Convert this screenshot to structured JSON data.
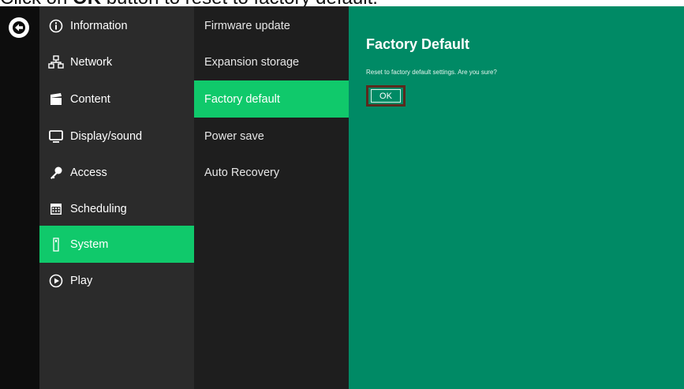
{
  "caption": {
    "prefix": "Click on ",
    "bold": "OK",
    "suffix": " button to reset to factory default."
  },
  "back_button": {
    "icon": "back-arrow-icon"
  },
  "menu": {
    "items": [
      {
        "label": "Information",
        "icon": "info-icon"
      },
      {
        "label": "Network",
        "icon": "network-icon"
      },
      {
        "label": "Content",
        "icon": "clapperboard-icon"
      },
      {
        "label": "Display/sound",
        "icon": "monitor-icon"
      },
      {
        "label": "Access",
        "icon": "key-icon"
      },
      {
        "label": "Scheduling",
        "icon": "calendar-icon"
      },
      {
        "label": "System",
        "icon": "system-icon",
        "active": true
      },
      {
        "label": "Play",
        "icon": "play-icon"
      }
    ]
  },
  "submenu": {
    "items": [
      {
        "label": "Firmware update"
      },
      {
        "label": "Expansion storage"
      },
      {
        "label": "Factory default",
        "active": true
      },
      {
        "label": "Power save"
      },
      {
        "label": "Auto Recovery"
      }
    ]
  },
  "content": {
    "title": "Factory Default",
    "message": "Reset to factory default settings. Are you sure?",
    "ok_label": "OK"
  },
  "colors": {
    "accent": "#10c96b",
    "panel": "#008a65",
    "menu_bg": "#2b2b2b",
    "submenu_bg": "#1e1e1e",
    "highlight_outline": "#5b2a1d"
  }
}
